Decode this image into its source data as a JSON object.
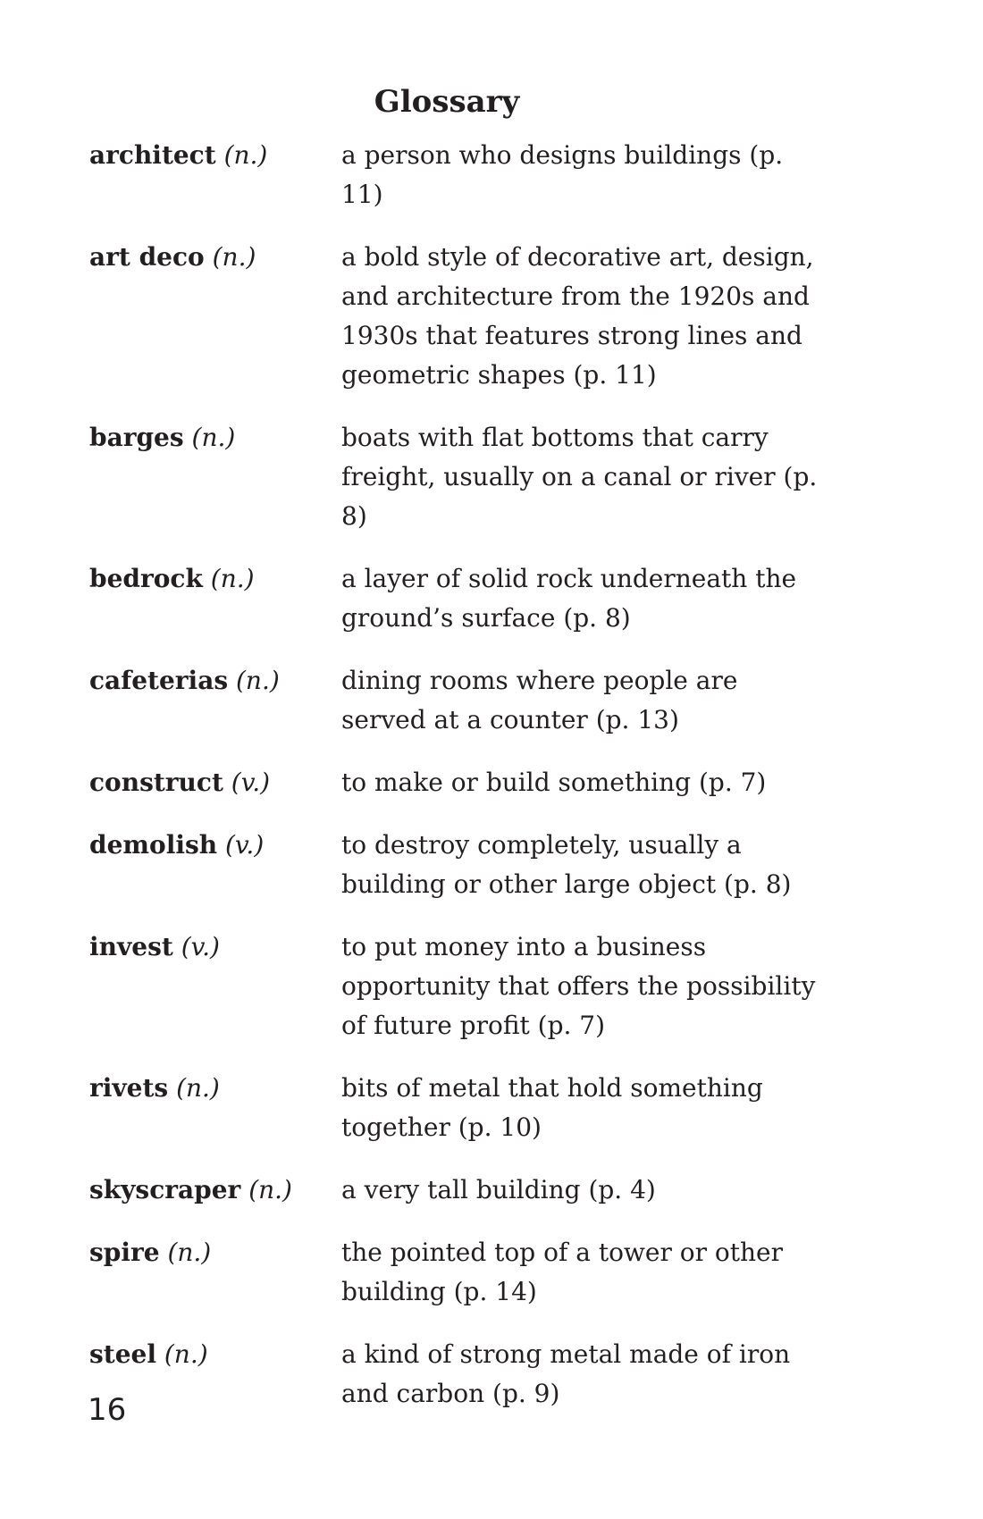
{
  "page": {
    "title": "Glossary",
    "page_number": "16"
  },
  "entries": [
    {
      "term": "architect",
      "pos": "(n.)",
      "definition": "a person who designs buildings (p. 11)"
    },
    {
      "term": "art deco",
      "pos": "(n.)",
      "definition": "a bold style of decorative art, design, and architecture from the 1920s and 1930s that features strong lines and geometric shapes (p. 11)"
    },
    {
      "term": "barges",
      "pos": "(n.)",
      "definition": "boats with flat bottoms that carry freight, usually on a canal or river (p. 8)"
    },
    {
      "term": "bedrock",
      "pos": "(n.)",
      "definition": "a layer of solid rock underneath the ground’s surface (p. 8)"
    },
    {
      "term": "cafeterias",
      "pos": "(n.)",
      "definition": "dining rooms where people are served at a counter (p. 13)"
    },
    {
      "term": "construct",
      "pos": "(v.)",
      "definition": "to make or build something (p. 7)"
    },
    {
      "term": "demolish",
      "pos": "(v.)",
      "definition": "to destroy completely, usually a building or other large object (p. 8)"
    },
    {
      "term": "invest",
      "pos": "(v.)",
      "definition": "to put money into a business opportunity that offers the possibility of future profit (p. 7)"
    },
    {
      "term": "rivets",
      "pos": "(n.)",
      "definition": "bits of metal that hold something together (p. 10)"
    },
    {
      "term": "skyscraper",
      "pos": "(n.)",
      "definition": "a very tall building (p. 4)"
    },
    {
      "term": "spire",
      "pos": "(n.)",
      "definition": "the pointed top of a tower or other building (p. 14)"
    },
    {
      "term": "steel",
      "pos": "(n.)",
      "definition": "a kind of strong metal made of iron and carbon (p. 9)"
    }
  ]
}
